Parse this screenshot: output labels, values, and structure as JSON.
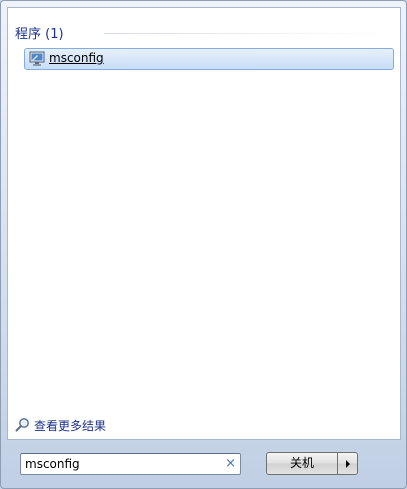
{
  "results": {
    "section_title": "程序 (1)",
    "items": [
      {
        "label": "msconfig",
        "icon": "system-configuration-icon"
      }
    ]
  },
  "see_more": {
    "label": "查看更多结果",
    "icon": "magnifier-icon"
  },
  "search": {
    "value": "msconfig",
    "clear_glyph": "×"
  },
  "shutdown": {
    "label": "关机",
    "arrow_icon": "arrow-right-icon"
  },
  "colors": {
    "header_text": "#1e3287",
    "highlight_border": "#84acdd",
    "highlight_fill": "#c8ddf7",
    "clear_icon": "#4a72b5"
  }
}
